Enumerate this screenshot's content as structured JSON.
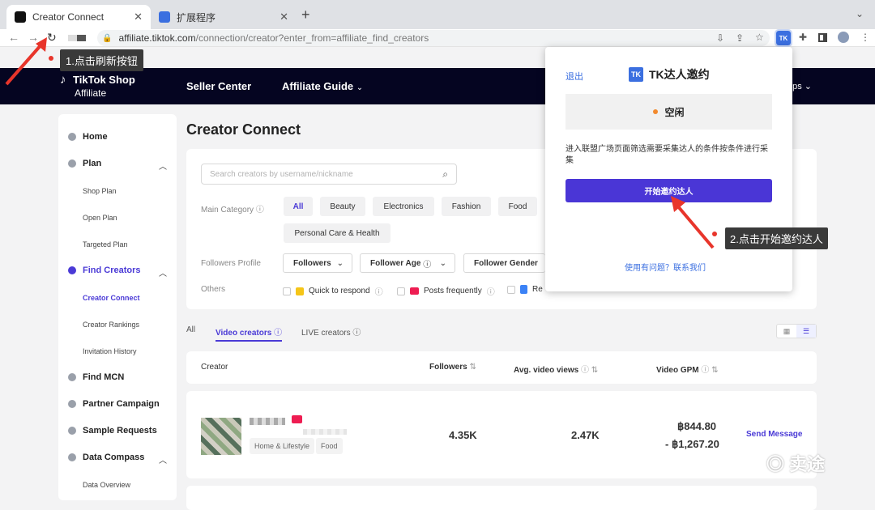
{
  "browser": {
    "tabs": [
      {
        "title": "Creator Connect"
      },
      {
        "title": "扩展程序"
      }
    ],
    "url_host": "affiliate.tiktok.com",
    "url_path": "/connection/creator?enter_from=affiliate_find_creators"
  },
  "annotations": {
    "step1": "1.点击刷新按钮",
    "step2": "2.点击开始邀约达人"
  },
  "header": {
    "logo_line1": "TikTok Shop",
    "logo_line2": "Affiliate",
    "nav": [
      "Seller Center",
      "Affiliate Guide"
    ],
    "right_text": "ops"
  },
  "sidebar": {
    "items": [
      {
        "label": "Home"
      },
      {
        "label": "Plan"
      },
      {
        "label": "Shop Plan"
      },
      {
        "label": "Open Plan"
      },
      {
        "label": "Targeted Plan"
      },
      {
        "label": "Find Creators"
      },
      {
        "label": "Creator Connect"
      },
      {
        "label": "Creator Rankings"
      },
      {
        "label": "Invitation History"
      },
      {
        "label": "Find MCN"
      },
      {
        "label": "Partner Campaign"
      },
      {
        "label": "Sample Requests"
      },
      {
        "label": "Data Compass"
      },
      {
        "label": "Data Overview"
      }
    ]
  },
  "main": {
    "title": "Creator Connect",
    "search_placeholder": "Search creators by username/nickname",
    "main_category_label": "Main Category",
    "categories": [
      "All",
      "Beauty",
      "Electronics",
      "Fashion",
      "Food",
      "Personal Care & Health"
    ],
    "followers_profile_label": "Followers Profile",
    "profile_dropdowns": [
      "Followers",
      "Follower Age",
      "Follower Gender"
    ],
    "others_label": "Others",
    "others": [
      "Quick to respond",
      "Posts frequently",
      "Re"
    ],
    "tabs": [
      "All",
      "Video creators",
      "LIVE creators"
    ],
    "columns": [
      "Creator",
      "Followers",
      "Avg. video views",
      "Video GPM"
    ],
    "row": {
      "tags": [
        "Home & Lifestyle",
        "Food"
      ],
      "followers": "4.35K",
      "avg_views": "2.47K",
      "gpm_high": "฿844.80",
      "gpm_low": "- ฿1,267.20",
      "action": "Send Message"
    }
  },
  "popup": {
    "logout": "退出",
    "brand_badge": "TK",
    "brand": "TK达人邀约",
    "status": "空闲",
    "description": "进入联盟广场页面筛选需要采集达人的条件按条件进行采集",
    "start_button": "开始邀约达人",
    "help": "使用有问题？联系我们"
  },
  "watermark": "卖途",
  "colors": {
    "accent": "#4a36d6",
    "header_bg": "#050521",
    "annotation_arrow": "#e8352b",
    "status_dot": "#f28a2e"
  }
}
